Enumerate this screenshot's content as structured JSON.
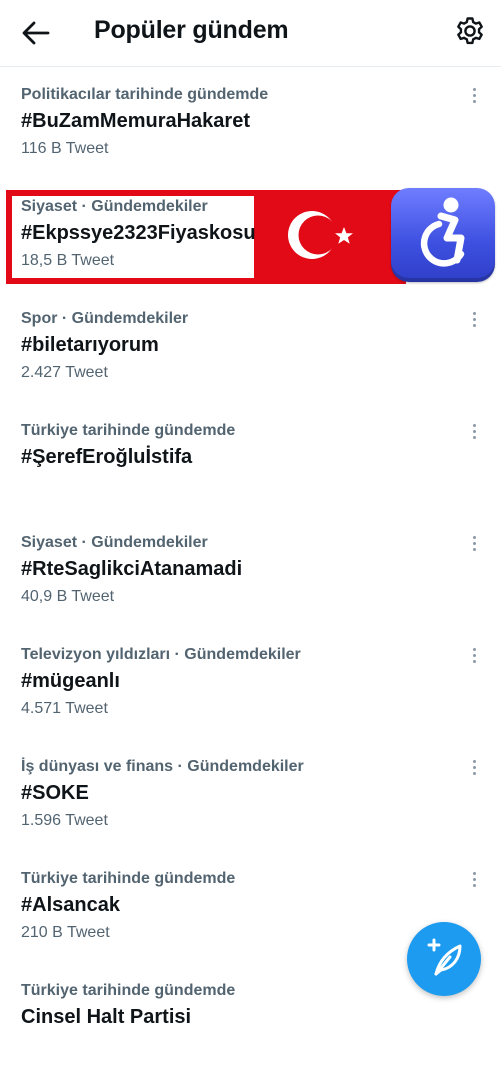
{
  "header": {
    "title": "Popüler gündem",
    "back_icon": "arrow-left-icon",
    "settings_icon": "gear-icon"
  },
  "trends": [
    {
      "category": "Politikacılar tarihinde gündemde",
      "name": "#BuZamMemuraHakaret",
      "count": "116 B Tweet"
    },
    {
      "category": "Siyaset · Gündemdekiler",
      "name": "#Ekpssye2323Fiyaskosu",
      "count": "18,5 B Tweet"
    },
    {
      "category": "Spor · Gündemdekiler",
      "name": "#biletarıyorum",
      "count": "2.427 Tweet"
    },
    {
      "category": "Türkiye tarihinde gündemde",
      "name": "#ŞerefEroğluİstifa",
      "count": ""
    },
    {
      "category": "Siyaset · Gündemdekiler",
      "name": "#RteSaglikciAtanamadi",
      "count": "40,9 B Tweet"
    },
    {
      "category": "Televizyon yıldızları · Gündemdekiler",
      "name": "#mügeanlı",
      "count": "4.571 Tweet"
    },
    {
      "category": "İş dünyası ve finans · Gündemdekiler",
      "name": "#SOKE",
      "count": "1.596 Tweet"
    },
    {
      "category": "Türkiye tarihinde gündemde",
      "name": "#Alsancak",
      "count": "210 B Tweet"
    },
    {
      "category": "Türkiye tarihinde gündemde",
      "name": "Cinsel Halt Partisi",
      "count": ""
    }
  ],
  "colors": {
    "accent": "#1d9bf0",
    "highlight_red": "#e30a17",
    "secondary_text": "#536471"
  },
  "fab_icon": "compose-tweet-icon"
}
